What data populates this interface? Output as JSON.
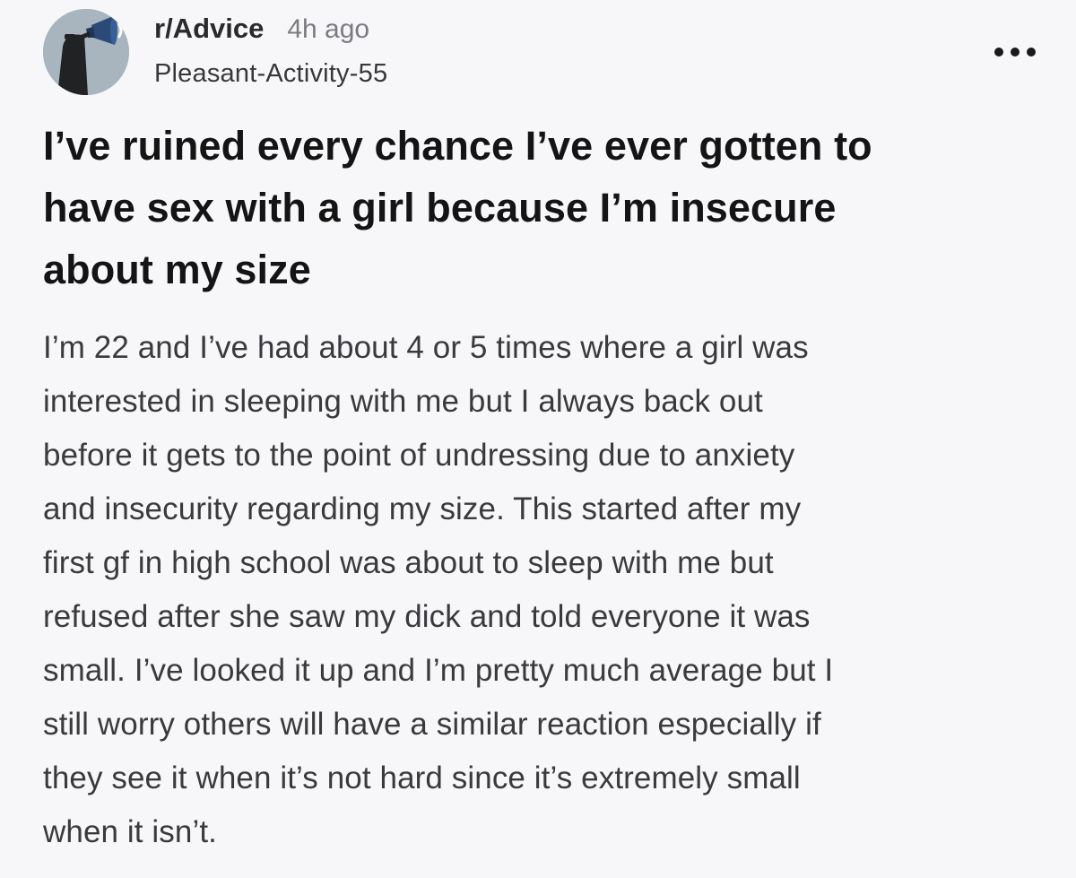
{
  "post": {
    "subreddit": "r/Advice",
    "time_ago": "4h ago",
    "author": "Pleasant-Activity-55",
    "more_icon": "ellipsis-horizontal",
    "title": "I’ve ruined every chance I’ve ever gotten to\nhave sex with a girl because I’m insecure\nabout my size",
    "body": "I’m 22 and I’ve had about 4 or 5 times where a girl was\ninterested in sleeping with me but I always back out\nbefore it gets to the point of undressing due to anxiety\nand insecurity regarding my size. This started after my\nfirst gf in high school was about to sleep with me but\nrefused after she saw my dick and told everyone it was\nsmall. I’ve looked it up and I’m pretty much average but I\nstill worry others will have a similar reaction especially if\nthey see it when it’s not hard since it’s extremely small\nwhen it isn’t."
  }
}
